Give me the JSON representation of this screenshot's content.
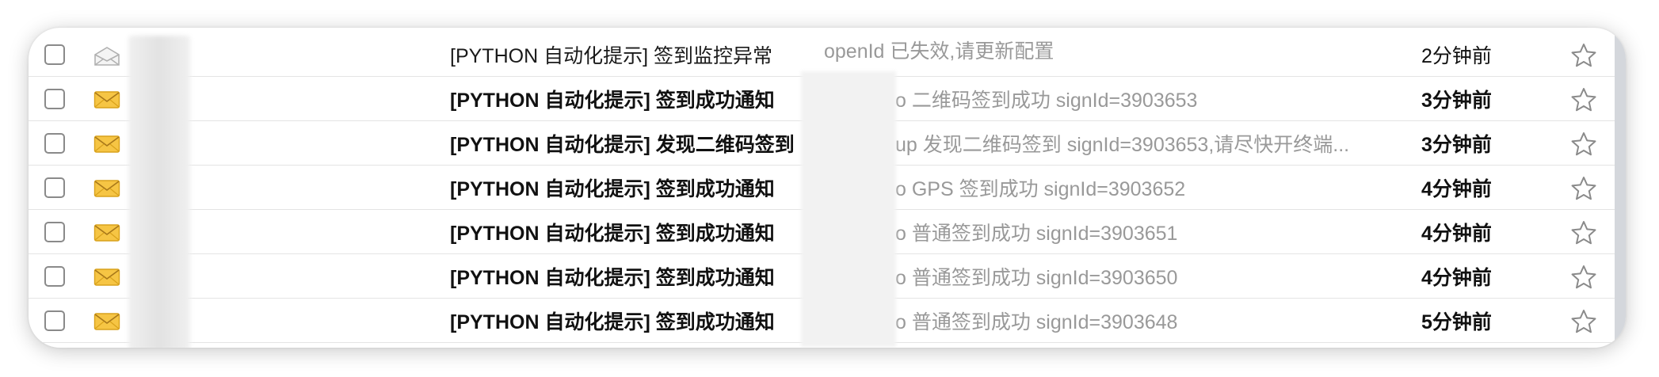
{
  "mail_list": {
    "rows": [
      {
        "read": true,
        "subject": "[PYTHON 自动化提示] 签到监控异常",
        "preview": "openId 已失效,请更新配置",
        "time": "2分钟前"
      },
      {
        "read": false,
        "subject": "[PYTHON 自动化提示] 签到成功通知",
        "preview": "o 二维码签到成功 signId=3903653",
        "time": "3分钟前"
      },
      {
        "read": false,
        "subject": "[PYTHON 自动化提示] 发现二维码签到",
        "preview": "up 发现二维码签到 signId=3903653,请尽快开终端...",
        "time": "3分钟前"
      },
      {
        "read": false,
        "subject": "[PYTHON 自动化提示] 签到成功通知",
        "preview": "o GPS 签到成功 signId=3903652",
        "time": "4分钟前"
      },
      {
        "read": false,
        "subject": "[PYTHON 自动化提示] 签到成功通知",
        "preview": "o 普通签到成功 signId=3903651",
        "time": "4分钟前"
      },
      {
        "read": false,
        "subject": "[PYTHON 自动化提示] 签到成功通知",
        "preview": "o 普通签到成功 signId=3903650",
        "time": "4分钟前"
      },
      {
        "read": false,
        "subject": "[PYTHON 自动化提示] 签到成功通知",
        "preview": "o 普通签到成功 signId=3903648",
        "time": "5分钟前"
      }
    ]
  },
  "colors": {
    "unread_envelope": "#f6c544",
    "read_envelope": "#b8b8b8",
    "star_outline": "#8a8a8a",
    "preview_text": "#999999"
  },
  "icons": {
    "checkbox": "checkbox-icon",
    "envelope_unread": "envelope-icon",
    "envelope_read": "envelope-open-icon",
    "star": "star-icon"
  }
}
